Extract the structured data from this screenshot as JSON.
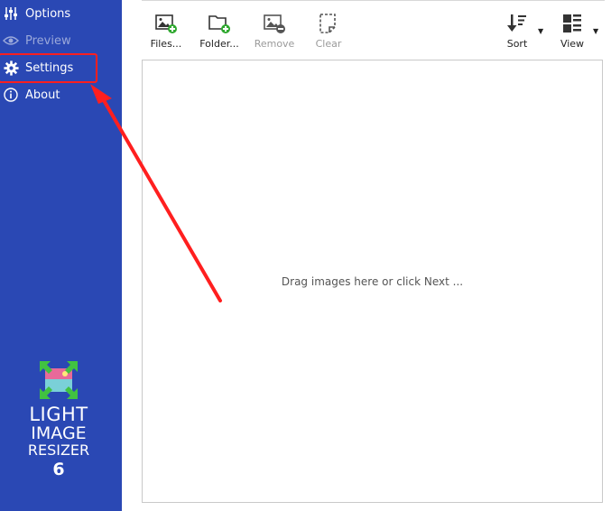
{
  "sidebar": {
    "items": [
      {
        "label": "Options",
        "icon": "sliders-icon"
      },
      {
        "label": "Preview",
        "icon": "eye-icon"
      },
      {
        "label": "Settings",
        "icon": "gear-icon"
      },
      {
        "label": "About",
        "icon": "info-icon"
      }
    ],
    "background": "#2a48b4"
  },
  "logo": {
    "line1": "LIGHT",
    "line2": "IMAGE",
    "line3": "RESIZER",
    "line4": "6"
  },
  "toolbar": {
    "files": "Files...",
    "folder": "Folder...",
    "remove": "Remove",
    "clear": "Clear",
    "sort": "Sort",
    "view": "View"
  },
  "main": {
    "drop_hint": "Drag images here or click Next ..."
  },
  "annotation": {
    "color": "#ff1f1f"
  }
}
